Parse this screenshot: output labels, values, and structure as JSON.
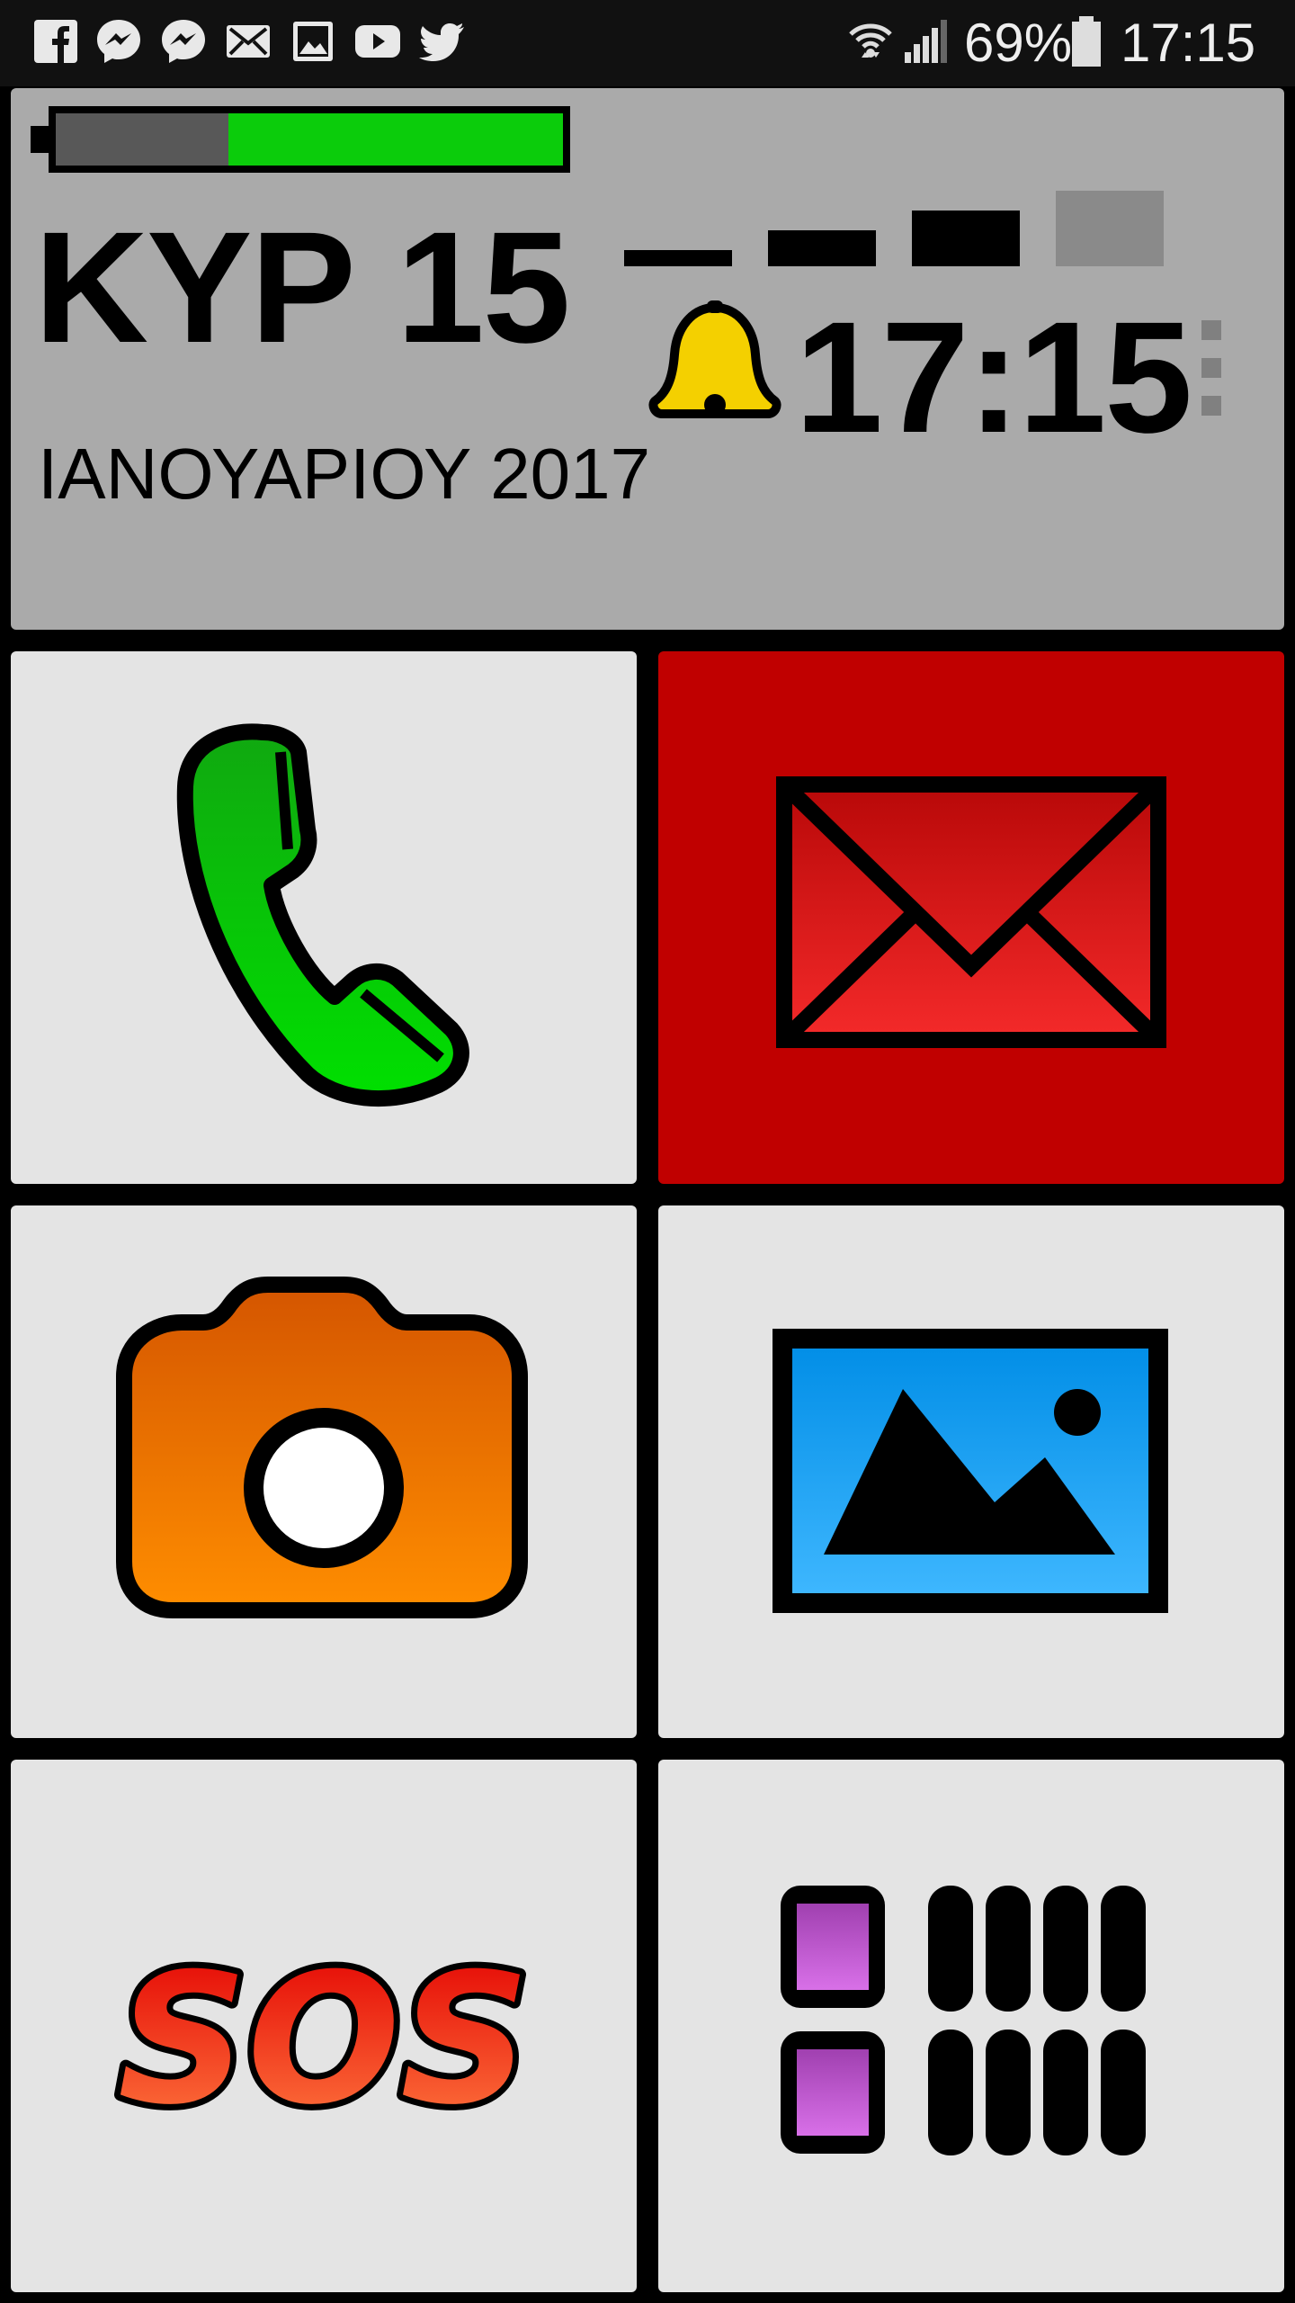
{
  "status_bar": {
    "notification_icons": [
      "facebook-icon",
      "messenger-icon",
      "messenger-icon",
      "email-icon",
      "gallery-icon",
      "youtube-icon",
      "twitter-icon"
    ],
    "wifi_icon": "wifi-icon",
    "signal_icon": "signal-icon",
    "battery_percent": "69%",
    "battery_icon": "battery-icon",
    "time": "17:15"
  },
  "header": {
    "battery_level": 0.66,
    "signal_strength": 3,
    "signal_max": 4,
    "day": "ΚΥΡ 15",
    "month_year": "ΙΑΝΟΥΑΡΙΟΥ 2017",
    "alarm_icon": "bell-icon",
    "time": "17:15",
    "menu_icon": "overflow-menu-icon"
  },
  "tiles": [
    {
      "name": "phone",
      "icon": "phone-icon",
      "background": "#e4e4e4"
    },
    {
      "name": "messages",
      "icon": "envelope-icon",
      "background": "#c00000"
    },
    {
      "name": "camera",
      "icon": "camera-icon",
      "background": "#e4e4e4"
    },
    {
      "name": "gallery",
      "icon": "image-icon",
      "background": "#e4e4e4"
    },
    {
      "name": "sos",
      "icon": "sos-icon",
      "label": "SOS",
      "background": "#e4e4e4"
    },
    {
      "name": "apps",
      "icon": "apps-grid-icon",
      "background": "#e4e4e4"
    }
  ],
  "colors": {
    "panel": "#aaaaaa",
    "tile": "#e4e4e4",
    "battery_fill": "#0bcc0b",
    "message_tile": "#c00000",
    "bell": "#f4d000"
  }
}
